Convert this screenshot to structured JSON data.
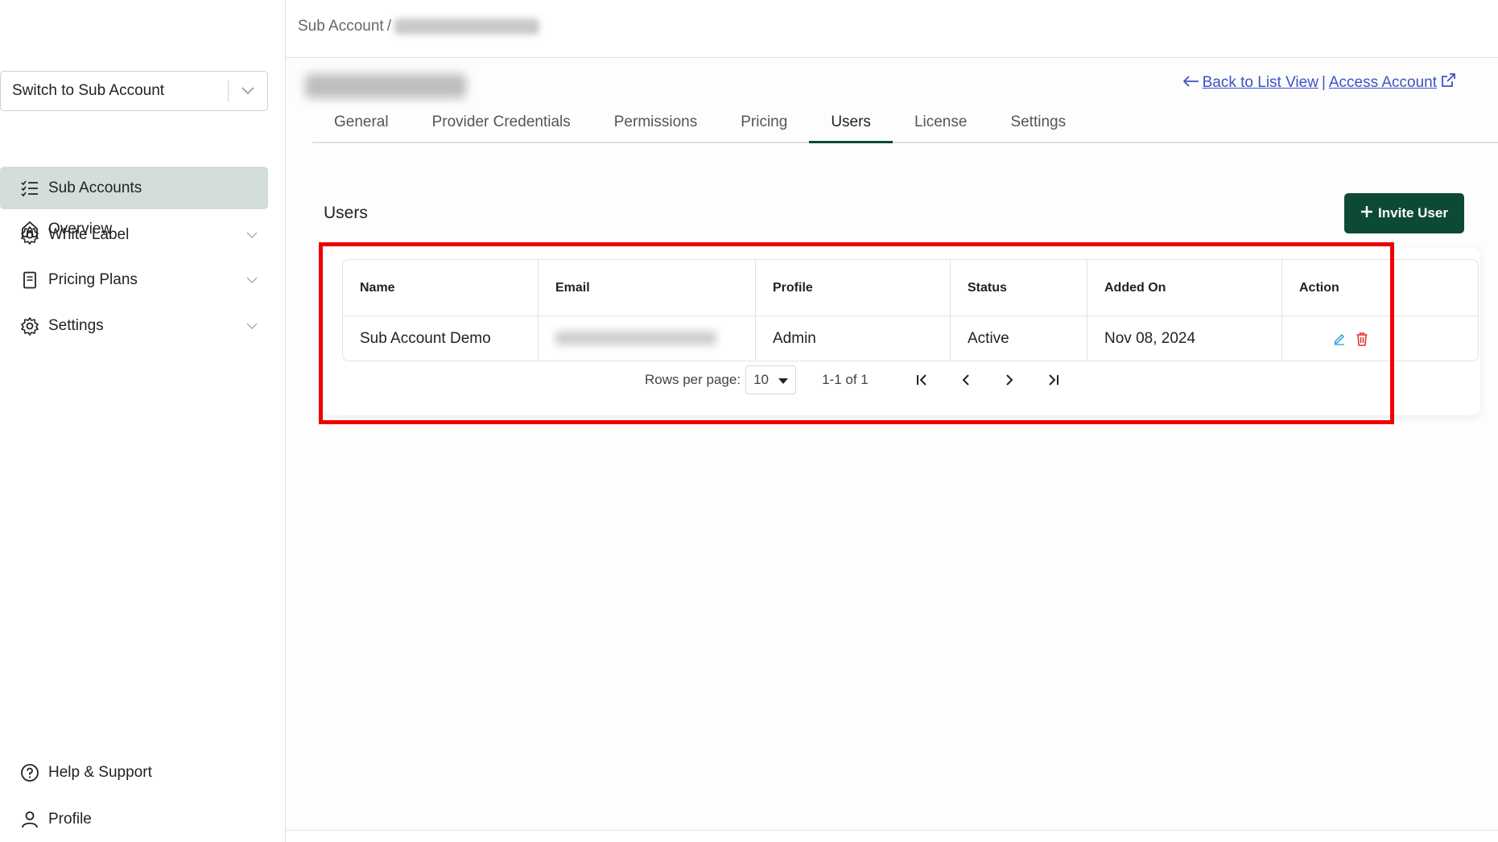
{
  "sidebar": {
    "switcher_label": "Switch to Sub Account",
    "items": [
      {
        "label": "Overview",
        "icon": "home-icon"
      },
      {
        "label": "Sub Accounts",
        "icon": "list-check-icon"
      },
      {
        "label": "White Label",
        "icon": "gear-icon"
      },
      {
        "label": "Pricing Plans",
        "icon": "document-icon"
      },
      {
        "label": "Settings",
        "icon": "gear-icon"
      }
    ],
    "footer": [
      {
        "label": "Help & Support",
        "icon": "help-circle-icon"
      },
      {
        "label": "Profile",
        "icon": "user-icon"
      }
    ]
  },
  "breadcrumb": {
    "root": "Sub Account",
    "separator": "/"
  },
  "header_links": {
    "back": "Back to List View",
    "separator": "|",
    "access": "Access Account"
  },
  "tabs": [
    "General",
    "Provider Credentials",
    "Permissions",
    "Pricing",
    "Users",
    "License",
    "Settings"
  ],
  "active_tab": "Users",
  "users": {
    "title": "Users",
    "invite_label": "Invite User",
    "columns": [
      "Name",
      "Email",
      "Profile",
      "Status",
      "Added On",
      "Action"
    ],
    "rows": [
      {
        "name": "Sub Account Demo",
        "profile": "Admin",
        "status": "Active",
        "added_on": "Nov 08, 2024"
      }
    ]
  },
  "pagination": {
    "rows_per_page_label": "Rows per page:",
    "rows_per_page": "10",
    "range": "1-1 of 1"
  },
  "colors": {
    "accent": "#0d4a36",
    "active_nav": "#d3ddd9",
    "link": "#3c52c4",
    "highlight": "#ee0000"
  }
}
